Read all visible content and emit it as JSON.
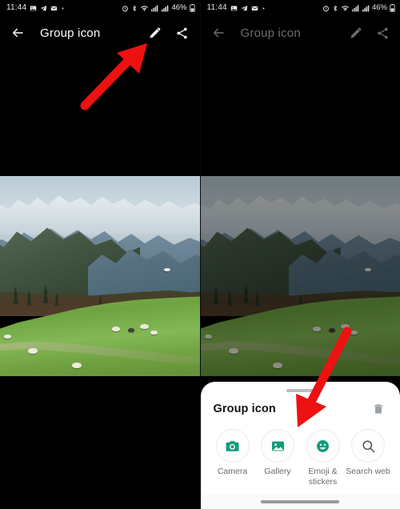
{
  "meta": {
    "accent_teal": "#0f9d7a",
    "arrow_red": "#ee1111",
    "sheet_bg": "#ffffff",
    "app_bg": "#000000"
  },
  "panels": [
    {
      "id": "left",
      "dimmed": false,
      "statusbar": {
        "time": "11:44",
        "battery_percent": "46%",
        "left_icons": [
          "gallery-icon",
          "telegram-icon",
          "mail-icon",
          "dot-icon"
        ],
        "right_icons": [
          "alarm-icon",
          "bluetooth-icon",
          "wifi-icon",
          "network-icon",
          "signal-icon",
          "battery-icon"
        ]
      },
      "toolbar": {
        "back_label": "back-arrow-icon",
        "title": "Group icon",
        "edit_label": "pencil-icon",
        "share_label": "share-icon"
      },
      "annotation": {
        "arrow": "arrow pointing up-right to the edit pencil"
      }
    },
    {
      "id": "right",
      "dimmed": true,
      "statusbar": {
        "time": "11:44",
        "battery_percent": "46%",
        "left_icons": [
          "gallery-icon",
          "telegram-icon",
          "mail-icon",
          "dot-icon"
        ],
        "right_icons": [
          "alarm-icon",
          "bluetooth-icon",
          "wifi-icon",
          "network-icon",
          "signal-icon",
          "battery-icon"
        ]
      },
      "toolbar": {
        "back_label": "back-arrow-icon",
        "title": "Group icon",
        "edit_label": "pencil-icon",
        "share_label": "share-icon"
      },
      "sheet": {
        "title": "Group icon",
        "delete_label": "trash-icon",
        "actions": [
          {
            "icon": "camera-icon",
            "label": "Camera"
          },
          {
            "icon": "gallery-image-icon",
            "label": "Gallery"
          },
          {
            "icon": "emoji-smiley-icon",
            "label": "Emoji &\nstickers"
          },
          {
            "icon": "search-icon",
            "label": "Search web"
          }
        ]
      },
      "annotation": {
        "arrow": "arrow pointing down-left to the Gallery action"
      }
    }
  ]
}
